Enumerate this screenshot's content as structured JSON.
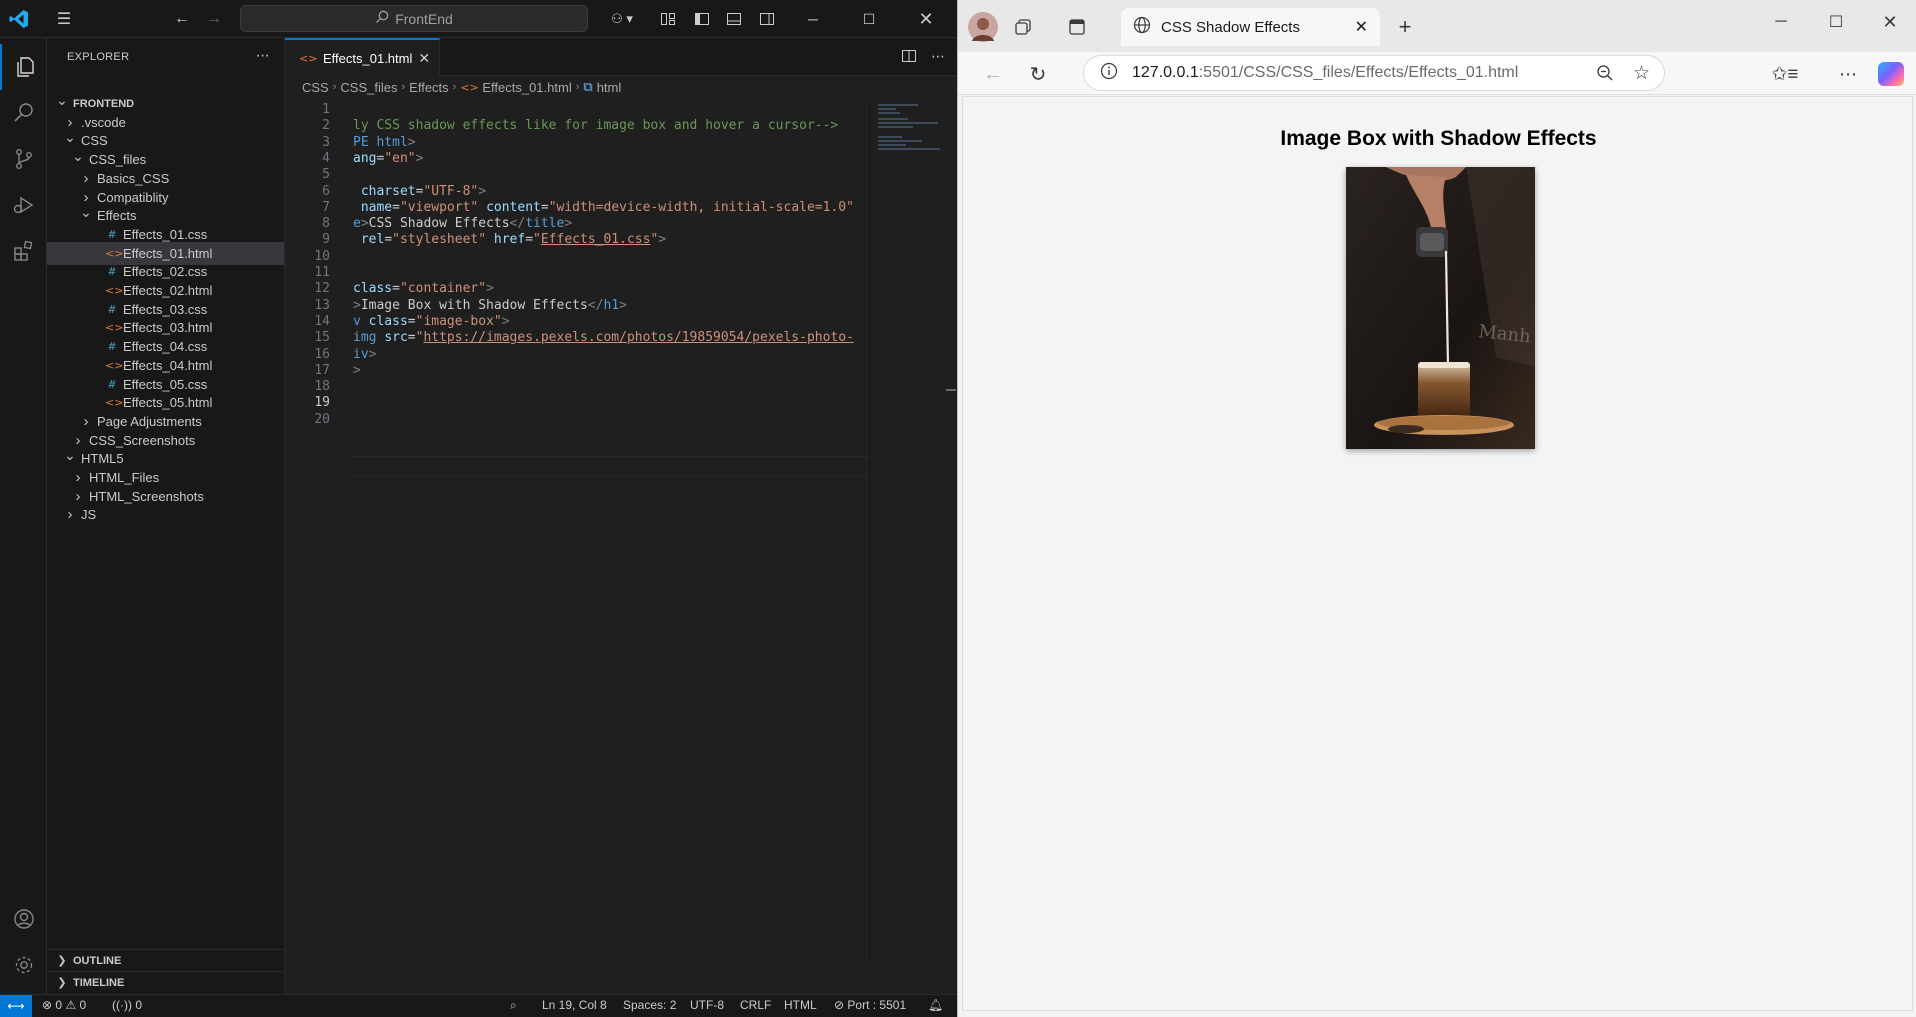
{
  "vscode": {
    "command_center": "FrontEnd",
    "explorer_title": "EXPLORER",
    "tree": [
      {
        "label": "FRONTEND",
        "depth": 0,
        "chev": "down",
        "icon": "",
        "bold": true
      },
      {
        "label": ".vscode",
        "depth": 1,
        "chev": "right",
        "icon": ""
      },
      {
        "label": "CSS",
        "depth": 1,
        "chev": "down",
        "icon": ""
      },
      {
        "label": "CSS_files",
        "depth": 2,
        "chev": "down",
        "icon": ""
      },
      {
        "label": "Basics_CSS",
        "depth": 3,
        "chev": "right",
        "icon": ""
      },
      {
        "label": "Compatiblity",
        "depth": 3,
        "chev": "right",
        "icon": ""
      },
      {
        "label": "Effects",
        "depth": 3,
        "chev": "down",
        "icon": ""
      },
      {
        "label": "Effects_01.css",
        "depth": 4,
        "chev": "",
        "icon": "css"
      },
      {
        "label": "Effects_01.html",
        "depth": 4,
        "chev": "",
        "icon": "html",
        "selected": true
      },
      {
        "label": "Effects_02.css",
        "depth": 4,
        "chev": "",
        "icon": "css"
      },
      {
        "label": "Effects_02.html",
        "depth": 4,
        "chev": "",
        "icon": "html"
      },
      {
        "label": "Effects_03.css",
        "depth": 4,
        "chev": "",
        "icon": "css"
      },
      {
        "label": "Effects_03.html",
        "depth": 4,
        "chev": "",
        "icon": "html"
      },
      {
        "label": "Effects_04.css",
        "depth": 4,
        "chev": "",
        "icon": "css"
      },
      {
        "label": "Effects_04.html",
        "depth": 4,
        "chev": "",
        "icon": "html"
      },
      {
        "label": "Effects_05.css",
        "depth": 4,
        "chev": "",
        "icon": "css"
      },
      {
        "label": "Effects_05.html",
        "depth": 4,
        "chev": "",
        "icon": "html"
      },
      {
        "label": "Page Adjustments",
        "depth": 3,
        "chev": "right",
        "icon": ""
      },
      {
        "label": "CSS_Screenshots",
        "depth": 2,
        "chev": "right",
        "icon": ""
      },
      {
        "label": "HTML5",
        "depth": 1,
        "chev": "down",
        "icon": ""
      },
      {
        "label": "HTML_Files",
        "depth": 2,
        "chev": "right",
        "icon": ""
      },
      {
        "label": "HTML_Screenshots",
        "depth": 2,
        "chev": "right",
        "icon": ""
      },
      {
        "label": "JS",
        "depth": 1,
        "chev": "right",
        "icon": ""
      }
    ],
    "outline_label": "OUTLINE",
    "timeline_label": "TIMELINE",
    "tab_label": "Effects_01.html",
    "breadcrumb": [
      "CSS",
      "CSS_files",
      "Effects",
      "Effects_01.html",
      "html"
    ],
    "code_lines": [
      {
        "n": "1",
        "html": ""
      },
      {
        "n": "2",
        "html": "<span class=\"c-com\">ly CSS shadow effects like for image box and hover a cursor--&gt;</span>"
      },
      {
        "n": "3",
        "html": "<span class=\"c-tag\">PE html</span><span class=\"c-br\">&gt;</span>"
      },
      {
        "n": "4",
        "html": "<span class=\"c-attr\">ang</span>=<span class=\"c-str\">\"en\"</span><span class=\"c-br\">&gt;</span>"
      },
      {
        "n": "5",
        "html": ""
      },
      {
        "n": "6",
        "html": "<span class=\"c-attr\"> charset</span>=<span class=\"c-str\">\"UTF-8\"</span><span class=\"c-br\">&gt;</span>"
      },
      {
        "n": "7",
        "html": "<span class=\"c-attr\"> name</span>=<span class=\"c-str\">\"viewport\"</span> <span class=\"c-attr\">content</span>=<span class=\"c-str\">\"width=device-width, initial-scale=1.0\"</span>"
      },
      {
        "n": "8",
        "html": "<span class=\"c-tag\">e</span><span class=\"c-br\">&gt;</span><span class=\"c-txt\">CSS Shadow Effects</span><span class=\"c-br\">&lt;/</span><span class=\"c-tag\">title</span><span class=\"c-br\">&gt;</span>"
      },
      {
        "n": "9",
        "html": "<span class=\"c-attr\"> rel</span>=<span class=\"c-str\">\"stylesheet\"</span> <span class=\"c-attr\">href</span>=<span class=\"c-str\">\"</span><span class=\"c-link\">Effects_01.css</span><span class=\"c-str\">\"</span><span class=\"c-br\">&gt;</span>"
      },
      {
        "n": "10",
        "html": ""
      },
      {
        "n": "11",
        "html": ""
      },
      {
        "n": "12",
        "html": "<span class=\"c-attr\">class</span>=<span class=\"c-str\">\"container\"</span><span class=\"c-br\">&gt;</span>"
      },
      {
        "n": "13",
        "html": "<span class=\"c-br\">&gt;</span><span class=\"c-txt\">Image Box with Shadow Effects</span><span class=\"c-br\">&lt;/</span><span class=\"c-tag\">h1</span><span class=\"c-br\">&gt;</span>"
      },
      {
        "n": "14",
        "html": "<span class=\"c-tag\">v</span> <span class=\"c-attr\">class</span>=<span class=\"c-str\">\"image-box\"</span><span class=\"c-br\">&gt;</span>"
      },
      {
        "n": "15",
        "html": "<span class=\"c-tag\">img</span> <span class=\"c-attr\">src</span>=<span class=\"c-str\">\"</span><span class=\"c-link\">https://images.pexels.com/photos/19859054/pexels-photo-</span>"
      },
      {
        "n": "16",
        "html": "<span class=\"c-tag\">iv</span><span class=\"c-br\">&gt;</span>"
      },
      {
        "n": "17",
        "html": "<span class=\"c-br\">&gt;</span>"
      },
      {
        "n": "18",
        "html": ""
      },
      {
        "n": "19",
        "html": ""
      },
      {
        "n": "20",
        "html": ""
      }
    ],
    "status": {
      "errors": "0",
      "warnings": "0",
      "ports": "0",
      "cursor": "Ln 19, Col 8",
      "spaces": "Spaces: 2",
      "encoding": "UTF-8",
      "eol": "CRLF",
      "language": "HTML",
      "port": "Port : 5501"
    }
  },
  "browser": {
    "tab_title": "CSS Shadow Effects",
    "url_host": "127.0.0.1",
    "url_path": ":5501/CSS/CSS_files/Effects/Effects_01.html",
    "page_heading": "Image Box with Shadow Effects"
  }
}
